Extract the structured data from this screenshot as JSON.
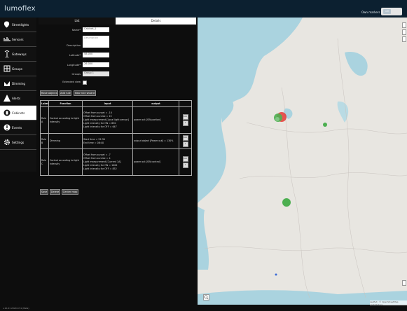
{
  "app": {
    "logo": "lumoflex"
  },
  "header": {
    "own_markers_label": "Own markers",
    "toggle_label": "Off"
  },
  "sidebar": {
    "items": [
      {
        "label": "Streetlights",
        "icon": "map-pin-icon"
      },
      {
        "label": "Sensors",
        "icon": "wifi-icon"
      },
      {
        "label": "Gateways",
        "icon": "antenna-icon"
      },
      {
        "label": "Groups",
        "icon": "grid-icon"
      },
      {
        "label": "Dimming",
        "icon": "chart-icon"
      },
      {
        "label": "Alerts",
        "icon": "warning-icon"
      },
      {
        "label": "Cabinets",
        "icon": "cabinet-icon"
      },
      {
        "label": "Events",
        "icon": "bell-icon"
      },
      {
        "label": "Settings",
        "icon": "gear-icon"
      }
    ],
    "active": "Cabinets"
  },
  "tabs": {
    "list": "List",
    "details": "Details"
  },
  "form": {
    "name_label": "Name*",
    "name_value": "Cabinet_1",
    "description_label": "Description",
    "description_placeholder": "Description",
    "latitude_label": "Latitude*",
    "latitude_value": "58.000",
    "longitude_label": "Longitude*",
    "longitude_value": "26.000",
    "groups_label": "Groups",
    "groups_value": "Group 1",
    "extended_view_label": "Extended view"
  },
  "actions": {
    "move_objects": "Move objects",
    "add_rule": "Add rule",
    "new_rule_wizard": "New rule wizard"
  },
  "rules_table": {
    "headers": [
      "Label",
      "Function",
      "Input",
      "output",
      ""
    ],
    "rows": [
      {
        "label": "Rule A",
        "function": "Control according to light intensity",
        "input": [
          "Offset from sunset = -10",
          "Offset from sunrise = 15",
          "Light measurement [Local light sensor]",
          "Light intensity for ON = 850",
          "Light intensity for OFF = 647"
        ],
        "output": "power out [SW portion]"
      },
      {
        "label": "Rule B",
        "function": "Dimming",
        "input": [
          "Start time = 22:30",
          "End time = 06:40"
        ],
        "output": "output object [Power out] = 130%"
      },
      {
        "label": "Rule C",
        "function": "Control according to light intensity",
        "input": [
          "Offset from sunset = -7",
          "Offset from sunrise = 4",
          "Light measurement [Current 1A]",
          "Light intensity for ON = 1002",
          "Light intensity for OFF = 852"
        ],
        "output": "power out [SW control]"
      }
    ],
    "edit_label": "Edit",
    "delete_label": "x"
  },
  "bottom_buttons": {
    "save": "Save",
    "delete": "Delete",
    "center_map": "Center map"
  },
  "footer": {
    "version": "v.10.61 2020.0.51 (Beta)"
  },
  "map": {
    "attribution": "Leaflet | © OpenStreetMap contributors"
  },
  "colors": {
    "topbar": "#0c2030",
    "sea": "#aad3df",
    "land": "#e6e4df",
    "marker_green": "#4caf50",
    "marker_red": "#e53935"
  }
}
